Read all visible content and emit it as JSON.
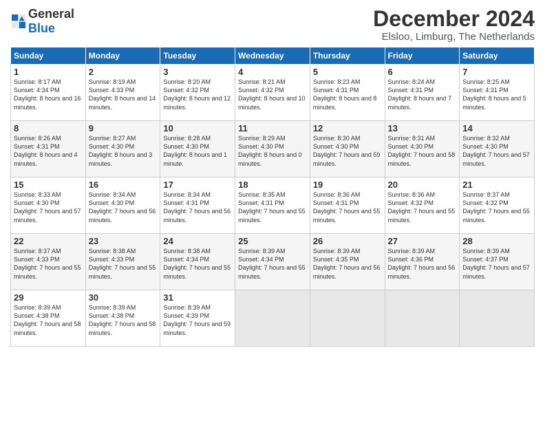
{
  "logo": {
    "general": "General",
    "blue": "Blue"
  },
  "title": "December 2024",
  "location": "Elsloo, Limburg, The Netherlands",
  "weekdays": [
    "Sunday",
    "Monday",
    "Tuesday",
    "Wednesday",
    "Thursday",
    "Friday",
    "Saturday"
  ],
  "weeks": [
    [
      {
        "day": "1",
        "sunrise": "8:17 AM",
        "sunset": "4:34 PM",
        "daylight": "8 hours and 16 minutes."
      },
      {
        "day": "2",
        "sunrise": "8:19 AM",
        "sunset": "4:33 PM",
        "daylight": "8 hours and 14 minutes."
      },
      {
        "day": "3",
        "sunrise": "8:20 AM",
        "sunset": "4:32 PM",
        "daylight": "8 hours and 12 minutes."
      },
      {
        "day": "4",
        "sunrise": "8:21 AM",
        "sunset": "4:32 PM",
        "daylight": "8 hours and 10 minutes."
      },
      {
        "day": "5",
        "sunrise": "8:23 AM",
        "sunset": "4:31 PM",
        "daylight": "8 hours and 8 minutes."
      },
      {
        "day": "6",
        "sunrise": "8:24 AM",
        "sunset": "4:31 PM",
        "daylight": "8 hours and 7 minutes."
      },
      {
        "day": "7",
        "sunrise": "8:25 AM",
        "sunset": "4:31 PM",
        "daylight": "8 hours and 5 minutes."
      }
    ],
    [
      {
        "day": "8",
        "sunrise": "8:26 AM",
        "sunset": "4:31 PM",
        "daylight": "8 hours and 4 minutes."
      },
      {
        "day": "9",
        "sunrise": "8:27 AM",
        "sunset": "4:30 PM",
        "daylight": "8 hours and 3 minutes."
      },
      {
        "day": "10",
        "sunrise": "8:28 AM",
        "sunset": "4:30 PM",
        "daylight": "8 hours and 1 minute."
      },
      {
        "day": "11",
        "sunrise": "8:29 AM",
        "sunset": "4:30 PM",
        "daylight": "8 hours and 0 minutes."
      },
      {
        "day": "12",
        "sunrise": "8:30 AM",
        "sunset": "4:30 PM",
        "daylight": "7 hours and 59 minutes."
      },
      {
        "day": "13",
        "sunrise": "8:31 AM",
        "sunset": "4:30 PM",
        "daylight": "7 hours and 58 minutes."
      },
      {
        "day": "14",
        "sunrise": "8:32 AM",
        "sunset": "4:30 PM",
        "daylight": "7 hours and 57 minutes."
      }
    ],
    [
      {
        "day": "15",
        "sunrise": "8:33 AM",
        "sunset": "4:30 PM",
        "daylight": "7 hours and 57 minutes."
      },
      {
        "day": "16",
        "sunrise": "8:34 AM",
        "sunset": "4:30 PM",
        "daylight": "7 hours and 56 minutes."
      },
      {
        "day": "17",
        "sunrise": "8:34 AM",
        "sunset": "4:31 PM",
        "daylight": "7 hours and 56 minutes."
      },
      {
        "day": "18",
        "sunrise": "8:35 AM",
        "sunset": "4:31 PM",
        "daylight": "7 hours and 55 minutes."
      },
      {
        "day": "19",
        "sunrise": "8:36 AM",
        "sunset": "4:31 PM",
        "daylight": "7 hours and 55 minutes."
      },
      {
        "day": "20",
        "sunrise": "8:36 AM",
        "sunset": "4:32 PM",
        "daylight": "7 hours and 55 minutes."
      },
      {
        "day": "21",
        "sunrise": "8:37 AM",
        "sunset": "4:32 PM",
        "daylight": "7 hours and 55 minutes."
      }
    ],
    [
      {
        "day": "22",
        "sunrise": "8:37 AM",
        "sunset": "4:33 PM",
        "daylight": "7 hours and 55 minutes."
      },
      {
        "day": "23",
        "sunrise": "8:38 AM",
        "sunset": "4:33 PM",
        "daylight": "7 hours and 55 minutes."
      },
      {
        "day": "24",
        "sunrise": "8:38 AM",
        "sunset": "4:34 PM",
        "daylight": "7 hours and 55 minutes."
      },
      {
        "day": "25",
        "sunrise": "8:39 AM",
        "sunset": "4:34 PM",
        "daylight": "7 hours and 55 minutes."
      },
      {
        "day": "26",
        "sunrise": "8:39 AM",
        "sunset": "4:35 PM",
        "daylight": "7 hours and 56 minutes."
      },
      {
        "day": "27",
        "sunrise": "8:39 AM",
        "sunset": "4:36 PM",
        "daylight": "7 hours and 56 minutes."
      },
      {
        "day": "28",
        "sunrise": "8:39 AM",
        "sunset": "4:37 PM",
        "daylight": "7 hours and 57 minutes."
      }
    ],
    [
      {
        "day": "29",
        "sunrise": "8:39 AM",
        "sunset": "4:38 PM",
        "daylight": "7 hours and 58 minutes."
      },
      {
        "day": "30",
        "sunrise": "8:39 AM",
        "sunset": "4:38 PM",
        "daylight": "7 hours and 58 minutes."
      },
      {
        "day": "31",
        "sunrise": "8:39 AM",
        "sunset": "4:39 PM",
        "daylight": "7 hours and 59 minutes."
      },
      null,
      null,
      null,
      null
    ]
  ]
}
